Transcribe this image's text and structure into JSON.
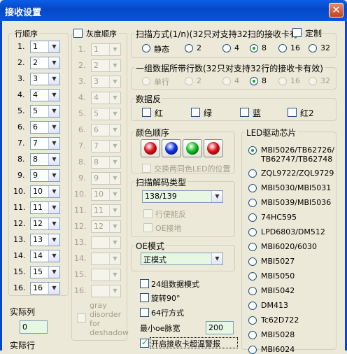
{
  "window": {
    "title": "接收设置",
    "close_label": "✕"
  },
  "row_order": {
    "legend": "行顺序",
    "rows": [
      {
        "n": "1.",
        "v": "1"
      },
      {
        "n": "2.",
        "v": "2"
      },
      {
        "n": "3.",
        "v": "3"
      },
      {
        "n": "4.",
        "v": "4"
      },
      {
        "n": "5.",
        "v": "5"
      },
      {
        "n": "6.",
        "v": "6"
      },
      {
        "n": "7.",
        "v": "7"
      },
      {
        "n": "8.",
        "v": "8"
      },
      {
        "n": "9.",
        "v": "9"
      },
      {
        "n": "10.",
        "v": "10"
      },
      {
        "n": "11.",
        "v": "11"
      },
      {
        "n": "12.",
        "v": "12"
      },
      {
        "n": "13.",
        "v": "13"
      },
      {
        "n": "14.",
        "v": "14"
      },
      {
        "n": "15.",
        "v": "15"
      },
      {
        "n": "16.",
        "v": "16"
      }
    ]
  },
  "gray_order": {
    "label": "灰度顺序",
    "rows": [
      {
        "n": "1.",
        "v": "1"
      },
      {
        "n": "2.",
        "v": "2"
      },
      {
        "n": "3.",
        "v": "3"
      },
      {
        "n": "4.",
        "v": "4"
      },
      {
        "n": "5.",
        "v": "5"
      },
      {
        "n": "6.",
        "v": "6"
      },
      {
        "n": "7.",
        "v": "7"
      },
      {
        "n": "8.",
        "v": "8"
      },
      {
        "n": "9.",
        "v": "9"
      },
      {
        "n": "10.",
        "v": "10"
      },
      {
        "n": "11.",
        "v": "11"
      },
      {
        "n": "12.",
        "v": "12"
      },
      {
        "n": "13.",
        "v": ""
      },
      {
        "n": "14.",
        "v": ""
      },
      {
        "n": "15.",
        "v": ""
      },
      {
        "n": "16.",
        "v": ""
      }
    ],
    "deshadow_label_1": "gray",
    "deshadow_label_2": "disorder",
    "deshadow_label_3": "for",
    "deshadow_label_4": "deshadow"
  },
  "actual": {
    "col_label": "实际列",
    "col_value": "0",
    "row_label": "实际行"
  },
  "scan_mode": {
    "legend": "扫描方式(1/n)(32只对支持32扫的接收卡有",
    "custom_label": "定制",
    "options": [
      "静态",
      "2",
      "4",
      "8",
      "16",
      "32"
    ],
    "selected": "8"
  },
  "rows_per_group": {
    "legend": "一组数据所带行数(32只对支持32行的接收卡有效)",
    "options": [
      "单行",
      "2",
      "4",
      "8",
      "16",
      "32"
    ],
    "selected": "8"
  },
  "data_invert": {
    "legend": "数据反",
    "options": [
      "红",
      "绿",
      "蓝",
      "红2"
    ]
  },
  "color_order": {
    "legend": "颜色顺序",
    "colors": [
      "#e0101a",
      "#1030e8",
      "#10c020",
      "#e0101a"
    ],
    "swap_label": "交换两同色LED的位置"
  },
  "scan_decode": {
    "legend": "扫描解码类型",
    "value": "138/139",
    "row_enable_label": "行使能反",
    "oe_ground_label": "OE接地"
  },
  "oe_mode": {
    "legend": "OE模式",
    "value": "正模式"
  },
  "options": {
    "opt1": "24组数据模式",
    "opt2": "旋转90°",
    "opt3": "64行方式",
    "min_oe_label": "最小oe脉宽",
    "min_oe_value": "200",
    "overheat_label": "开启接收卡超温警报"
  },
  "led_chip": {
    "legend": "LED驱动芯片",
    "chips": [
      "MBI5026/TB62726/\nTB62747/TB62748",
      "ZQL9722/ZQL9729",
      "MBI5030/MBI5031",
      "MBI5039/MBI5036",
      "74HC595",
      "LPD6803/DM512",
      "MBI6020/6030",
      "MBI5027",
      "MBI5050",
      "MBI5042",
      "DM413",
      "Tc62D722",
      "MBI5028",
      "MBI6024"
    ],
    "selected_index": 0
  }
}
